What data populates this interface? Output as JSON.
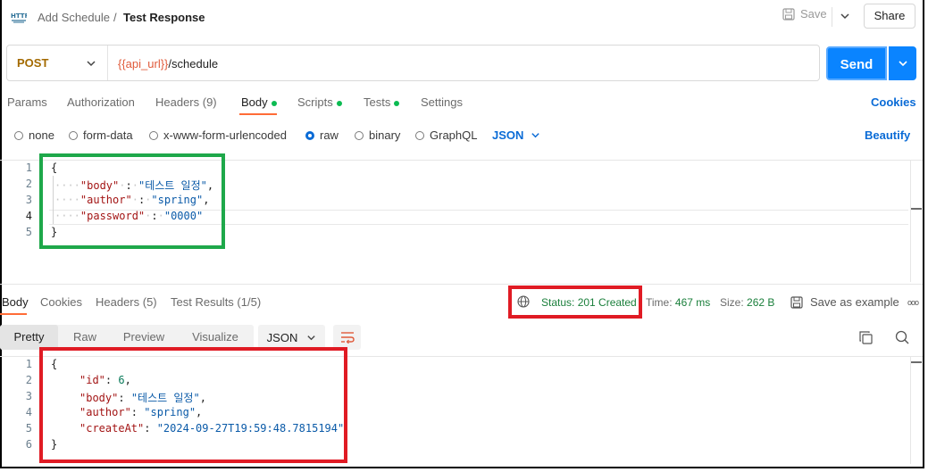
{
  "header": {
    "http_badge": "HTTP",
    "breadcrumb_parent": "Add Schedule",
    "breadcrumb_sep": "/",
    "title": "Test Response",
    "save_label": "Save",
    "share_label": "Share"
  },
  "request": {
    "method": "POST",
    "url_var": "{{api_url}}",
    "url_path": "/schedule",
    "send_label": "Send"
  },
  "request_tabs": {
    "params": "Params",
    "authorization": "Authorization",
    "headers": "Headers (9)",
    "body": "Body",
    "scripts": "Scripts",
    "tests": "Tests",
    "settings": "Settings",
    "cookies": "Cookies"
  },
  "body_options": {
    "none": "none",
    "form_data": "form-data",
    "urlencoded": "x-www-form-urlencoded",
    "raw": "raw",
    "binary": "binary",
    "graphql": "GraphQL",
    "format": "JSON",
    "beautify": "Beautify"
  },
  "request_body": {
    "line_numbers": [
      "1",
      "2",
      "3",
      "4",
      "5"
    ],
    "open": "{",
    "close": "}",
    "k1": "\"body\"",
    "v1": "\"테스트 일정\"",
    "k2": "\"author\"",
    "v2": "\"spring\"",
    "k3": "\"password\"",
    "v3": "\"0000\""
  },
  "response_tabs": {
    "body": "Body",
    "cookies": "Cookies",
    "headers": "Headers (5)",
    "test_results": "Test Results (1/5)"
  },
  "response_meta": {
    "status": "Status: 201 Created",
    "time_label": "Time:",
    "time_value": "467 ms",
    "size_label": "Size:",
    "size_value": "262 B",
    "save_example": "Save as example",
    "more": "ooo"
  },
  "view_modes": {
    "pretty": "Pretty",
    "raw": "Raw",
    "preview": "Preview",
    "visualize": "Visualize",
    "format": "JSON"
  },
  "response_body": {
    "line_numbers": [
      "1",
      "2",
      "3",
      "4",
      "5",
      "6"
    ],
    "open": "{",
    "close": "}",
    "k1": "\"id\"",
    "v1": "6",
    "k2": "\"body\"",
    "v2": "\"테스트 일정\"",
    "k3": "\"author\"",
    "v3": "\"spring\"",
    "k4": "\"createAt\"",
    "v4": "\"2024-09-27T19:59:48.7815194\""
  },
  "colors": {
    "accent_blue": "#0a84ff",
    "highlight_green": "#1ea84a",
    "highlight_red": "#e01b24",
    "status_green": "#1a7f3b"
  }
}
